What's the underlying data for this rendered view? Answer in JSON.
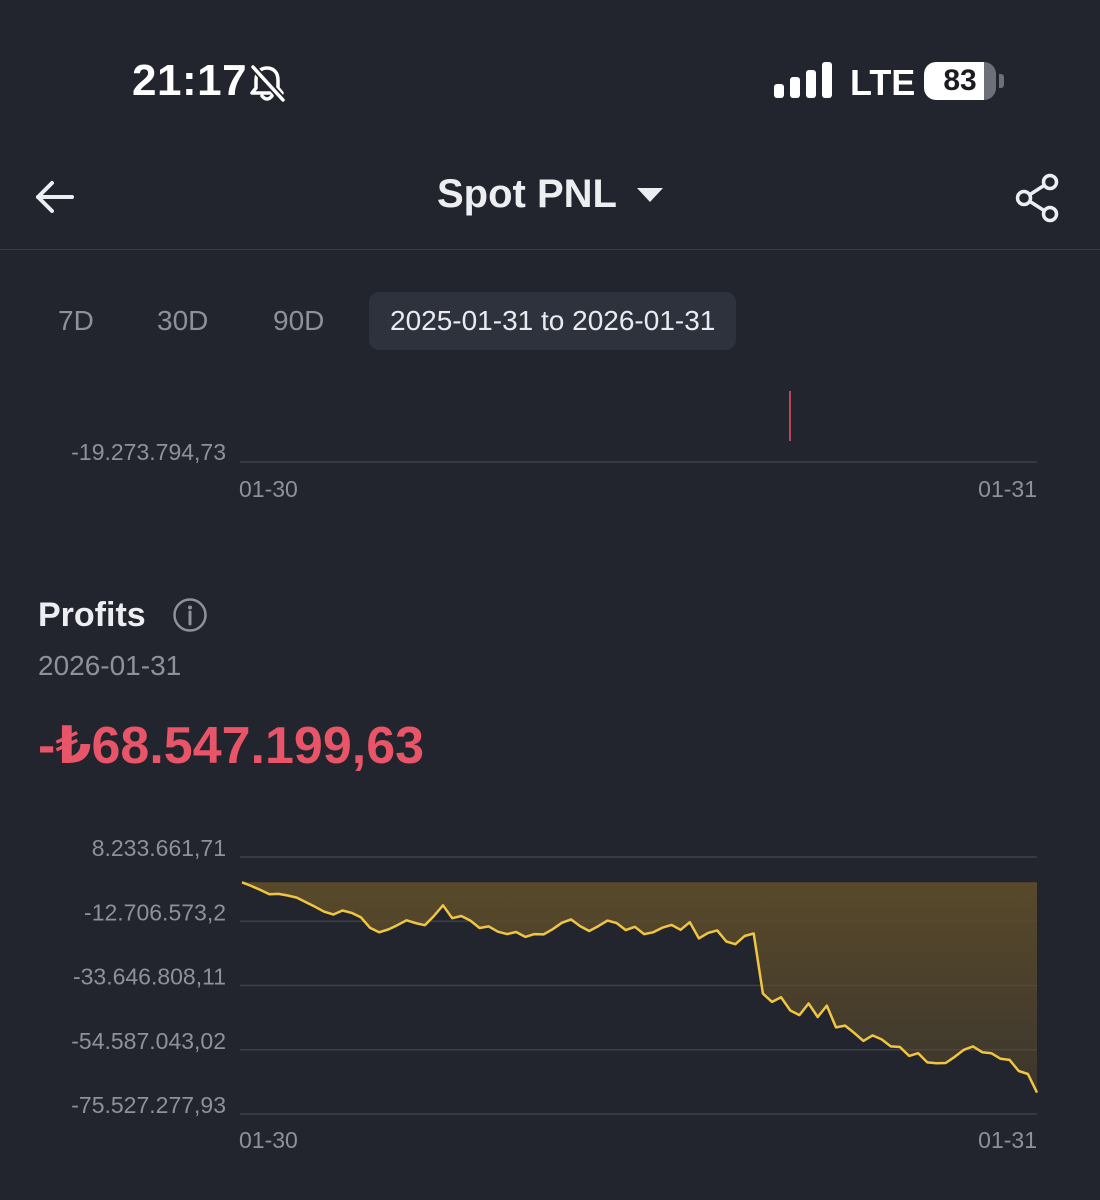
{
  "status_bar": {
    "time": "21:17",
    "network": "LTE",
    "battery": "83",
    "battery_level": 0.83
  },
  "header": {
    "title": "Spot PNL"
  },
  "range_tabs": [
    {
      "label": "7D",
      "active": false
    },
    {
      "label": "30D",
      "active": false
    },
    {
      "label": "90D",
      "active": false
    },
    {
      "label": "2025-01-31 to 2026-01-31",
      "active": true
    }
  ],
  "top_chart": {
    "y_label": "-19.273.794,73",
    "x_start": "01-30",
    "x_end": "01-31"
  },
  "profits": {
    "title": "Profits",
    "date": "2026-01-31",
    "value": "-₺68.547.199,63"
  },
  "colors": {
    "background": "#22252e",
    "negative": "#e85468",
    "line": "#f0c541",
    "fill": "#5b4b2a",
    "grid": "#3c404b",
    "muted": "#8c919c"
  },
  "chart_data": {
    "type": "area",
    "title": "",
    "xlabel": "",
    "ylabel": "",
    "x_tick_labels": [
      "01-30",
      "01-31"
    ],
    "y_tick_labels": [
      "8.233.661,71",
      "-12.706.573,2",
      "-33.646.808,11",
      "-54.587.043,02",
      "-75.527.277,93"
    ],
    "ylim": [
      -75527277.93,
      8233661.71
    ],
    "grid": true,
    "series": [
      {
        "values": [
          0,
          -1200000,
          -2500000,
          -3900000,
          -3800000,
          -4300000,
          -5000000,
          -6500000,
          -8000000,
          -9600000,
          -10500000,
          -9200000,
          -10000000,
          -11400000,
          -14800000,
          -16300000,
          -15400000,
          -14000000,
          -12400000,
          -13300000,
          -14000000,
          -11000000,
          -7500000,
          -11700000,
          -11000000,
          -12500000,
          -14900000,
          -14400000,
          -16100000,
          -16900000,
          -16200000,
          -17800000,
          -16900000,
          -17000000,
          -15300000,
          -13200000,
          -12100000,
          -14300000,
          -15900000,
          -14300000,
          -12500000,
          -13300000,
          -15600000,
          -14500000,
          -16900000,
          -16300000,
          -14800000,
          -13900000,
          -15500000,
          -13000000,
          -18300000,
          -16500000,
          -15700000,
          -19300000,
          -20200000,
          -17500000,
          -16700000,
          -36300000,
          -39000000,
          -37500000,
          -41800000,
          -43300000,
          -39500000,
          -43900000,
          -40200000,
          -47300000,
          -46700000,
          -49100000,
          -51700000,
          -49900000,
          -51200000,
          -53500000,
          -53700000,
          -56600000,
          -55700000,
          -58700000,
          -59000000,
          -58900000,
          -56900000,
          -54600000,
          -53500000,
          -55400000,
          -55700000,
          -57500000,
          -57900000,
          -61500000,
          -62500000,
          -68547199.63
        ]
      }
    ]
  }
}
